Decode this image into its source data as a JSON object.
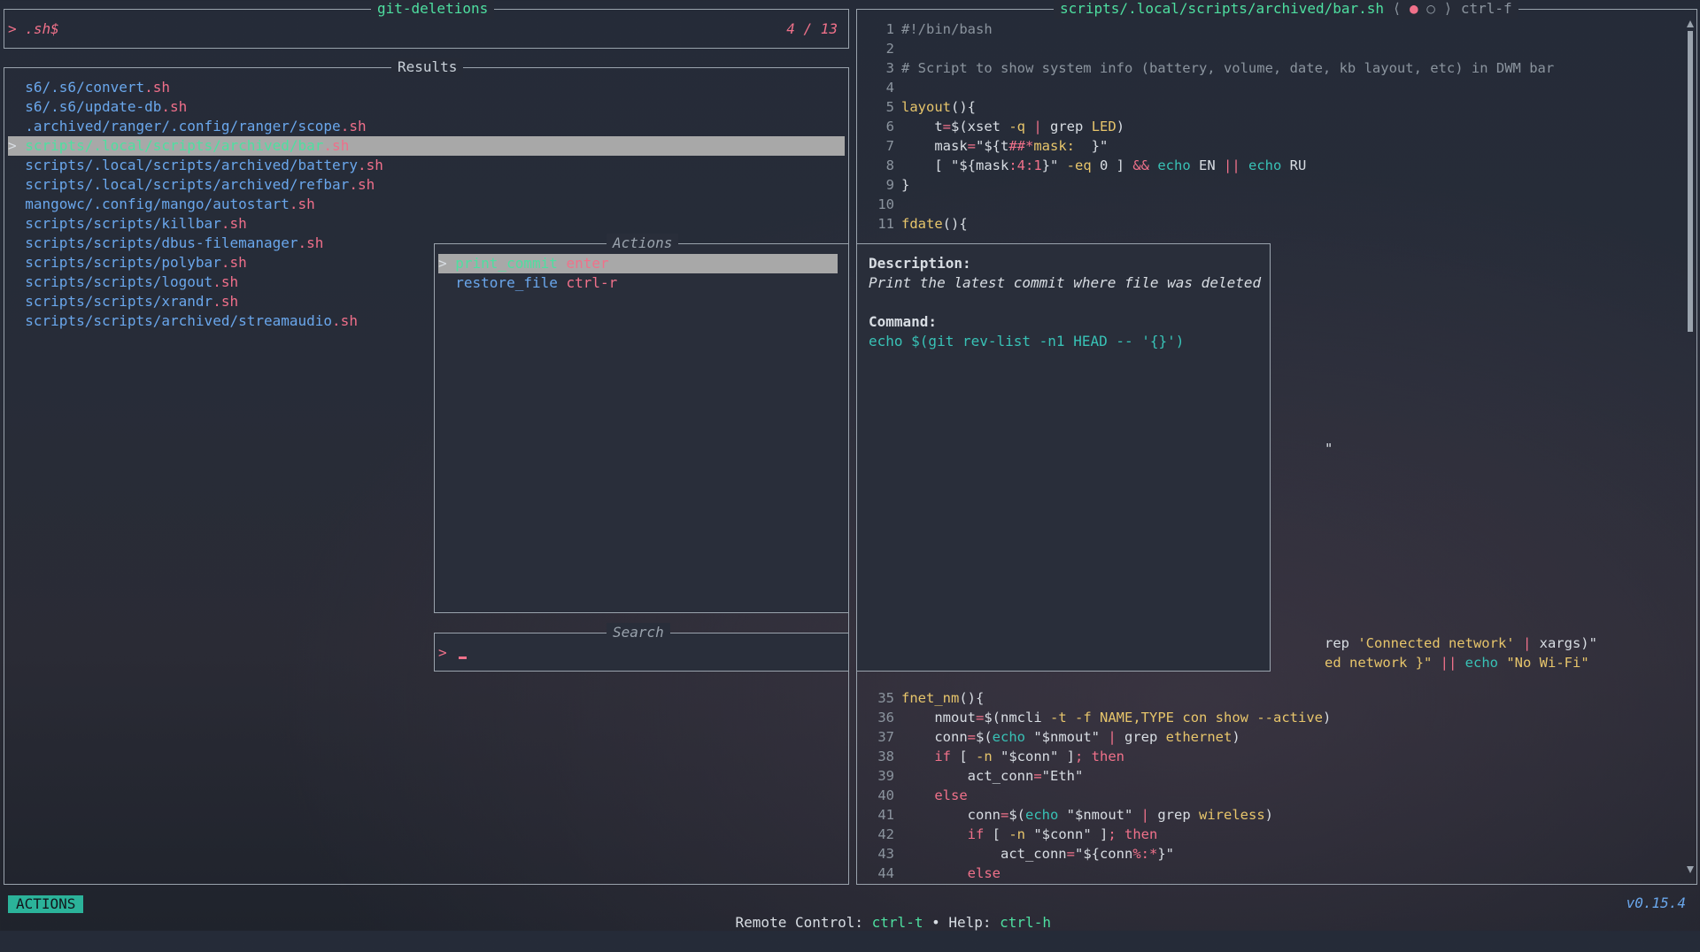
{
  "app": {
    "title": "git-deletions",
    "query_prompt": ">",
    "query": ".sh$",
    "count": "4 / 13"
  },
  "results": {
    "title": "Results",
    "items": [
      {
        "dir": "s6/.s6/convert",
        "ext": ".sh"
      },
      {
        "dir": "s6/.s6/update-db",
        "ext": ".sh"
      },
      {
        "dir": ".archived/ranger/.config/ranger/scope",
        "ext": ".sh"
      },
      {
        "dir": "scripts/.local/scripts/archived/bar",
        "ext": ".sh",
        "selected": true
      },
      {
        "dir": "scripts/.local/scripts/archived/battery",
        "ext": ".sh"
      },
      {
        "dir": "scripts/.local/scripts/archived/refbar",
        "ext": ".sh"
      },
      {
        "dir": "mangowc/.config/mango/autostart",
        "ext": ".sh"
      },
      {
        "dir": "scripts/scripts/killbar",
        "ext": ".sh"
      },
      {
        "dir": "scripts/scripts/dbus-filemanager",
        "ext": ".sh"
      },
      {
        "dir": "scripts/scripts/polybar",
        "ext": ".sh"
      },
      {
        "dir": "scripts/scripts/logout",
        "ext": ".sh"
      },
      {
        "dir": "scripts/scripts/xrandr",
        "ext": ".sh"
      },
      {
        "dir": "scripts/scripts/archived/streamaudio",
        "ext": ".sh"
      }
    ]
  },
  "preview": {
    "title": "scripts/.local/scripts/archived/bar.sh",
    "nav_left": "⟨",
    "dot_filled": "●",
    "dot_empty": "○",
    "nav_right": "⟩",
    "shortcut": "ctrl-f"
  },
  "actions": {
    "title": "Actions",
    "items": [
      {
        "name": "print_commit",
        "key": "enter",
        "selected": true
      },
      {
        "name": "restore_file",
        "key": "ctrl-r"
      }
    ]
  },
  "description": {
    "desc_label": "Description:",
    "desc_text": "Print the latest commit where file was deleted",
    "cmd_label": "Command:",
    "cmd_text": "echo $(git rev-list -n1 HEAD -- '{}')"
  },
  "search": {
    "title": "Search",
    "prompt": ">"
  },
  "code_fragments": {
    "stray_quote": "\"",
    "line_a_pre": "rep ",
    "line_a_str": "'Connected network'",
    "line_a_pipe": " | ",
    "line_a_post": "xargs)\"",
    "line_b_pre": "ed network }\" ",
    "line_b_or": "||",
    "line_b_echo": " echo ",
    "line_b_str": "\"No Wi-Fi\""
  },
  "statusbar": {
    "mode": "ACTIONS",
    "remote_label": "Remote Control: ",
    "remote_key": "ctrl-t",
    "sep": " • ",
    "help_label": "Help: ",
    "help_key": "ctrl-h",
    "version": "v0.15.4"
  },
  "colors": {
    "accent": "#4edfa0",
    "mode_bg": "#2bb39a",
    "pink": "#f0718a",
    "link": "#6aa7ec"
  }
}
